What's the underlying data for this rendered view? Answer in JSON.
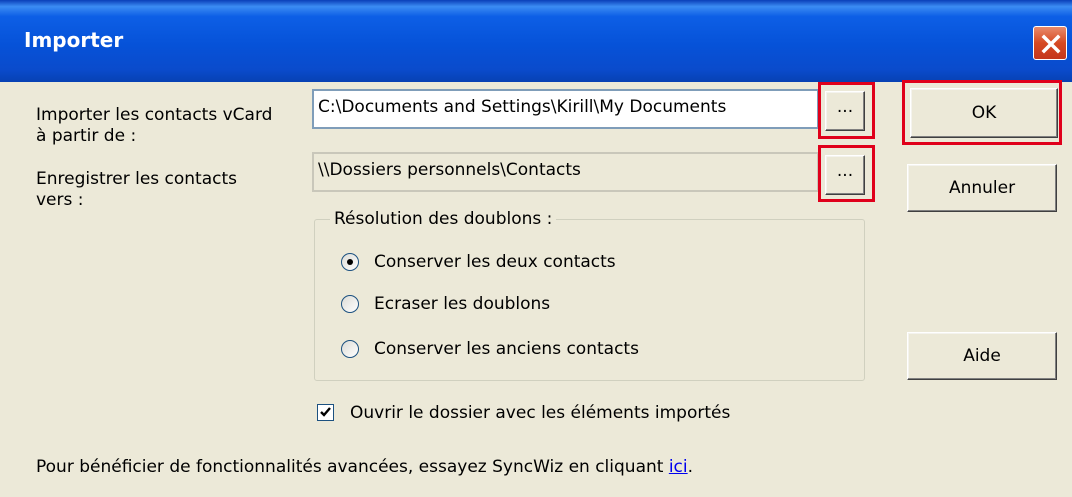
{
  "window": {
    "title": "Importer",
    "close_icon": "close-icon"
  },
  "form": {
    "import_label_line1": "Importer les contacts vCard",
    "import_label_line2": "à partir de :",
    "import_path": "C:\\Documents and Settings\\Kirill\\My Documents",
    "save_label_line1": "Enregistrer les contacts",
    "save_label_line2": "vers :",
    "save_path": "\\\\Dossiers personnels\\Contacts",
    "browse_label": "..."
  },
  "duplicates": {
    "title": "Résolution des doublons :",
    "options": [
      {
        "label": "Conserver les deux contacts",
        "selected": true
      },
      {
        "label": "Ecraser les doublons",
        "selected": false
      },
      {
        "label": "Conserver les anciens contacts",
        "selected": false
      }
    ]
  },
  "open_folder": {
    "label": "Ouvrir le dossier avec les éléments importés",
    "checked": true
  },
  "buttons": {
    "ok": "OK",
    "cancel": "Annuler",
    "help": "Aide"
  },
  "footer": {
    "text": "Pour bénéficier de fonctionnalités avancées, essayez SyncWiz en cliquant ",
    "link": "ici",
    "suffix": "."
  },
  "colors": {
    "highlight": "#e0001b",
    "title_bar": "#0652d8",
    "dialog_bg": "#ece9d8"
  }
}
